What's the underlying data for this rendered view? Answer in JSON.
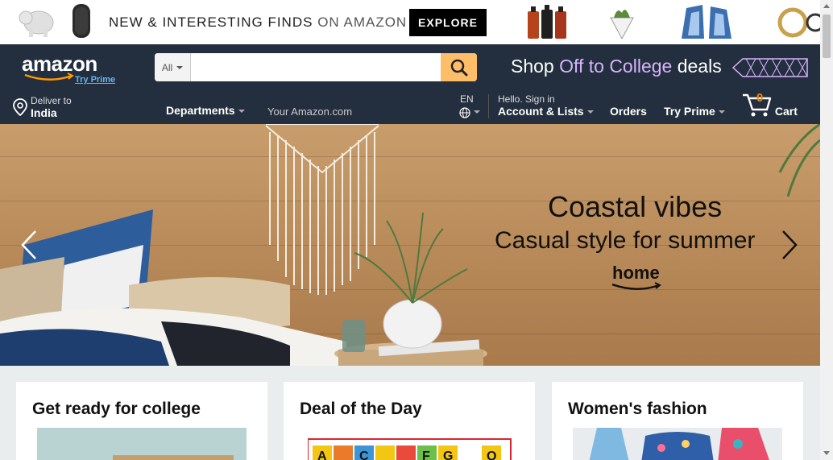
{
  "promo": {
    "text_bold": "NEW & INTERESTING FINDS",
    "text_thin": "ON AMAZON",
    "explore_label": "EXPLORE"
  },
  "header": {
    "logo_text": "amazon",
    "try_prime_logo": "Try Prime",
    "search": {
      "category": "All",
      "value": "",
      "placeholder": ""
    },
    "banner": {
      "shop": "Shop",
      "highlight": "Off to College",
      "deals": "deals"
    }
  },
  "subnav": {
    "deliver_small": "Deliver to",
    "deliver_big": "India",
    "departments": "Departments",
    "your_amazon": "Your Amazon.com",
    "lang": "EN",
    "hello": "Hello. Sign in",
    "account": "Account & Lists",
    "orders": "Orders",
    "try_prime": "Try Prime",
    "cart_count": "0",
    "cart_label": "Cart"
  },
  "hero": {
    "title": "Coastal vibes",
    "subtitle": "Casual style for summer",
    "brand": "home"
  },
  "cards": [
    {
      "title": "Get ready for college"
    },
    {
      "title": "Deal of the Day"
    },
    {
      "title": "Women's fashion"
    }
  ],
  "colors": {
    "nav_bg": "#232f3e",
    "search_btn": "#febd69",
    "cart_count": "#f08804",
    "link_blue": "#64b5f6"
  }
}
